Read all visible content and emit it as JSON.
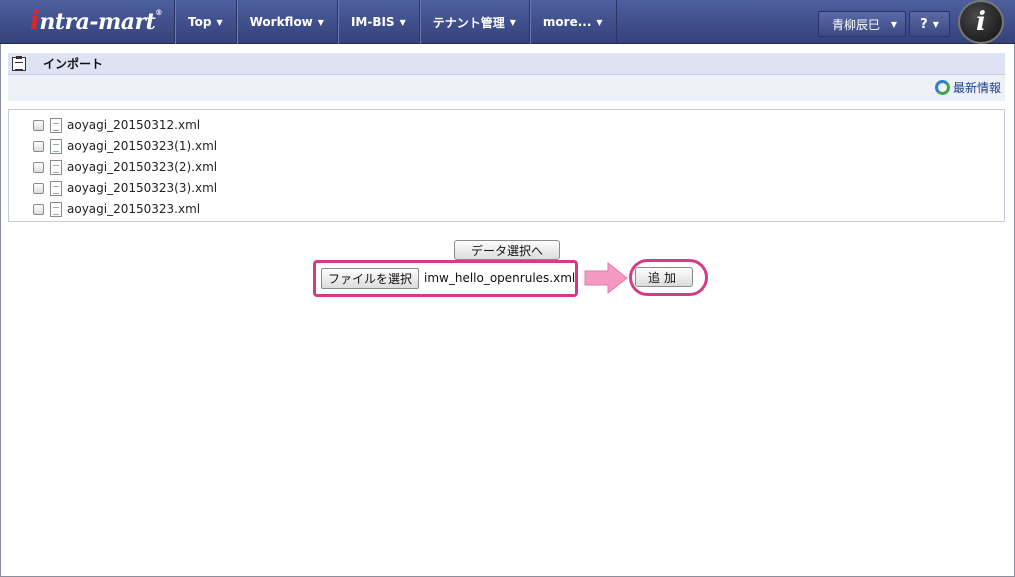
{
  "header": {
    "logo_prefix": "i",
    "logo_text": "ntra-mart",
    "logo_mark": "®",
    "nav": [
      {
        "label": "Top"
      },
      {
        "label": "Workflow"
      },
      {
        "label": "IM-BIS"
      },
      {
        "label": "テナント管理"
      },
      {
        "label": "more..."
      }
    ],
    "user_name": "青柳辰巳",
    "help_label": "?",
    "brand_letter": "i",
    "caret": "▼"
  },
  "page": {
    "title": "インポート",
    "refresh_label": "最新情報"
  },
  "files": [
    {
      "name": "aoyagi_20150312.xml"
    },
    {
      "name": "aoyagi_20150323(1).xml"
    },
    {
      "name": "aoyagi_20150323(2).xml"
    },
    {
      "name": "aoyagi_20150323(3).xml"
    },
    {
      "name": "aoyagi_20150323.xml"
    }
  ],
  "controls": {
    "data_select_label": "データ選択へ",
    "file_choose_label": "ファイルを選択",
    "selected_file": "imw_hello_openrules.xml",
    "add_label": "追加"
  },
  "colors": {
    "header": "#3d4c88",
    "highlight": "#d63c86",
    "arrow": "#f49ac2"
  }
}
